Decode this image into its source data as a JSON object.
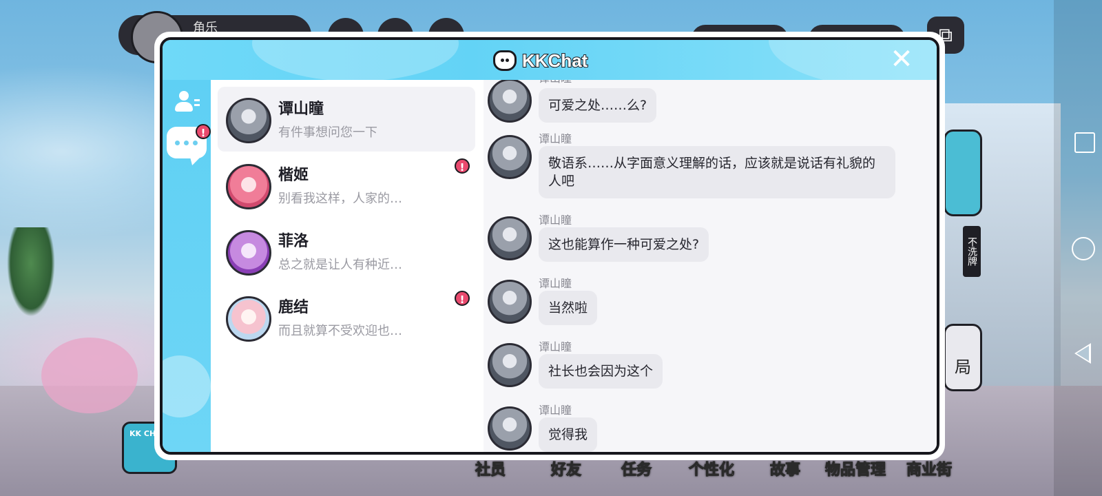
{
  "background": {
    "user_name": "角乐",
    "bottom_nav": [
      "社员",
      "好友",
      "任务",
      "个性化",
      "故事",
      "物品管理",
      "商业街"
    ],
    "side_tag": "不洗牌",
    "side_card_text": "局",
    "left_card_text": "KK CHAT"
  },
  "app": {
    "title": "KKChat",
    "close_label": "✕"
  },
  "sidebar": {
    "alert_label": "!"
  },
  "contacts": [
    {
      "name": "谭山瞳",
      "preview": "有件事想问您一下",
      "active": true,
      "alert": false,
      "avatar": "gray"
    },
    {
      "name": "楷姬",
      "preview": "别看我这样，人家的…",
      "active": false,
      "alert": true,
      "avatar": "pink"
    },
    {
      "name": "菲洛",
      "preview": "总之就是让人有种近…",
      "active": false,
      "alert": false,
      "avatar": "purple"
    },
    {
      "name": "鹿结",
      "preview": "而且就算不受欢迎也…",
      "active": false,
      "alert": true,
      "avatar": "light"
    }
  ],
  "messages": [
    {
      "sender": "谭山瞳",
      "text": "可爱之处……么?"
    },
    {
      "sender": "谭山瞳",
      "text": "敬语系……从字面意义理解的话，应该就是说话有礼貌的人吧"
    },
    {
      "sender": "谭山瞳",
      "text": "这也能算作一种可爱之处?"
    },
    {
      "sender": "谭山瞳",
      "text": "当然啦"
    },
    {
      "sender": "谭山瞳",
      "text": "社长也会因为这个"
    },
    {
      "sender": "谭山瞳",
      "text": "觉得我"
    }
  ],
  "colors": {
    "header": "#63d3f6",
    "alert": "#e94a6e",
    "bubble": "#e9e9ee"
  }
}
